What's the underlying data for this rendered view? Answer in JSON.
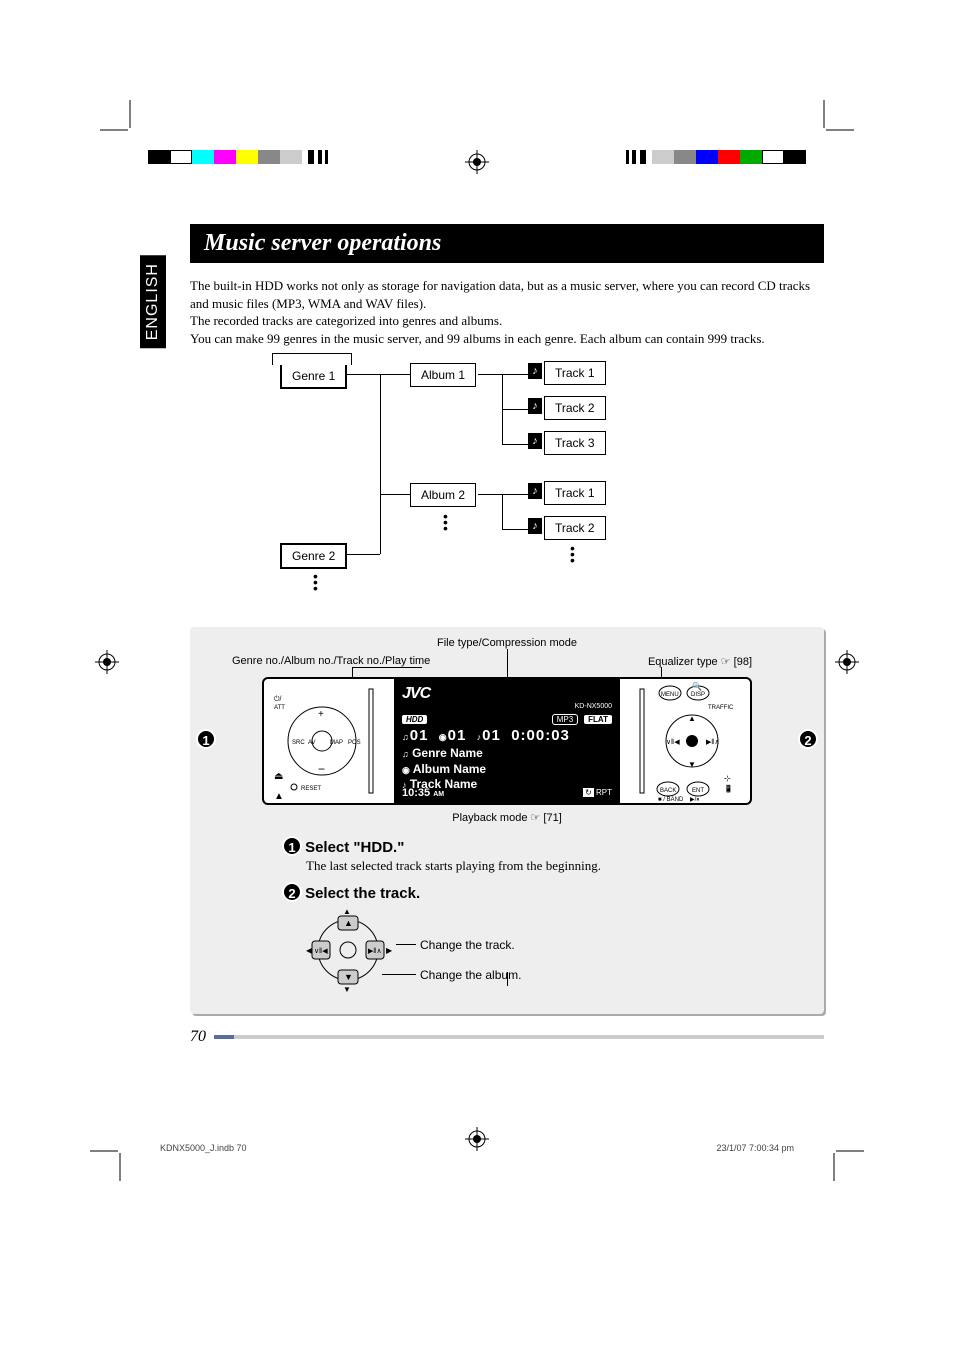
{
  "lang_tab": "ENGLISH",
  "title": "Music server operations",
  "intro": {
    "p1": "The built-in HDD works not only as storage for navigation data, but as a music server, where you can record CD tracks and music files (MP3, WMA and WAV files).",
    "p2": "The recorded tracks are categorized into genres and albums.",
    "p3": "You can make 99 genres in the music server, and 99 albums in each genre. Each album can contain 999 tracks."
  },
  "hierarchy": {
    "genre1": "Genre 1",
    "genre2": "Genre 2",
    "album1": "Album 1",
    "album2": "Album 2",
    "track1": "Track 1",
    "track2": "Track 2",
    "track3": "Track 3",
    "track1b": "Track 1",
    "track2b": "Track 2"
  },
  "callouts": {
    "filetype": "File type/Compression mode",
    "genre_album": "Genre no./Album no./Track no./Play time",
    "eq": "Equalizer type ☞ [98]",
    "playback": "Playback mode ☞ [71]"
  },
  "device": {
    "logo": "JVC",
    "model": "KD-NX5000",
    "hdd": "HDD",
    "mp3": "MP3",
    "flat": "FLAT",
    "nums": "01   01   01   0:00:03",
    "genre_name": "Genre Name",
    "album_name": "Album Name",
    "track_name": "Track Name",
    "clock": "10:35",
    "ampm": "AM",
    "rpt": "RPT",
    "left_labels": {
      "att": "ATT",
      "src": "SRC",
      "av": "AV",
      "map": "MAP",
      "pos": "POS",
      "reset": "RESET"
    },
    "right_labels": {
      "menu": "MENU",
      "disp": "DISP",
      "traffic": "TRAFFIC",
      "back": "BACK",
      "ent": "ENT",
      "band": "/ BAND"
    }
  },
  "steps": {
    "s1_title": "Select \"HDD.\"",
    "s1_body": "The last selected track starts playing from the beginning.",
    "s2_title": "Select the track.",
    "change_track": "Change the track.",
    "change_album": "Change the album."
  },
  "page_number": "70",
  "footer": {
    "left": "KDNX5000_J.indb   70",
    "right": "23/1/07   7:00:34 pm"
  }
}
